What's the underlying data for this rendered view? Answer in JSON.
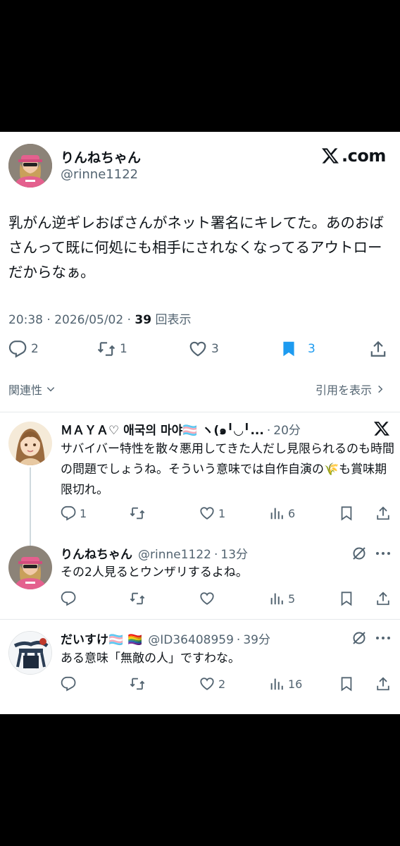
{
  "post": {
    "author_name": "りんねちゃん",
    "author_handle": "@rinne1122",
    "site_label": "X.com",
    "text": "乳がん逆ギレおばさんがネット署名にキレてた。あのおばさんって既に何処にも相手にされなくなってるアウトローだからなぁ。",
    "meta_time": "20:38 · 2026/05/02 · ",
    "meta_views_count": "39",
    "meta_views_label": " 回表示",
    "stats": {
      "replies": "2",
      "reposts": "1",
      "likes": "3",
      "bookmarks": "3"
    },
    "related_label": "関連性",
    "quotes_label": "引用を表示"
  },
  "replies": [
    {
      "name": "ＭＡＹＡ♡ 애국의 마야🏳️‍⚧️ ヽ(๑╹◡╹...",
      "time": "20分",
      "text": "サバイバー特性を散々悪用してきた人だし見限られるのも時間の問題でしょうね。そういう意味では自作自演の🌾も賞味期限切れ。",
      "stats": {
        "replies": "1",
        "reposts": "",
        "likes": "1",
        "views": "6"
      }
    },
    {
      "name": "りんねちゃん",
      "handle": "@rinne1122",
      "time": "13分",
      "text": "その2人見るとウンザリするよね。",
      "stats": {
        "replies": "",
        "reposts": "",
        "likes": "",
        "views": "5"
      }
    },
    {
      "name": "だいすけ🏳️‍⚧️ 🏳️‍🌈",
      "handle": "@ID36408959",
      "time": "39分",
      "text": "ある意味「無敵の人」ですわな。",
      "stats": {
        "replies": "",
        "reposts": "",
        "likes": "2",
        "views": "16"
      }
    }
  ],
  "colors": {
    "accent": "#1d9bf0",
    "text": "#0f1419",
    "muted": "#536471",
    "avatar_pink": "#e4608e"
  },
  "icons": [
    "reply-icon",
    "repost-icon",
    "like-icon",
    "bookmark-icon",
    "share-icon",
    "views-icon",
    "x-logo-icon",
    "grok-icon",
    "more-icon",
    "chevron-down-icon",
    "chevron-right-icon"
  ]
}
